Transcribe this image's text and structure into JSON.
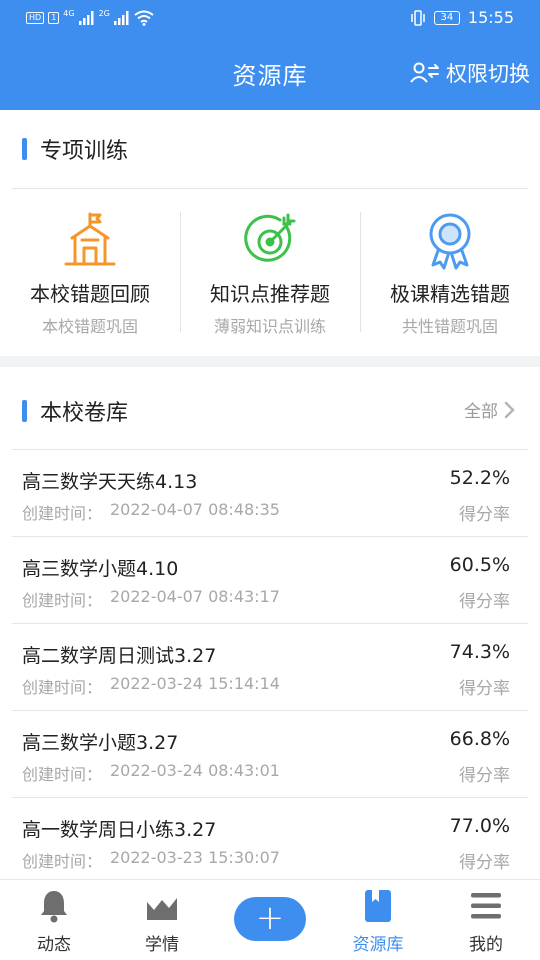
{
  "status_bar": {
    "hd_tag": "HD",
    "sim1_tag": "1",
    "signal1_type": "4G",
    "signal2_type": "2G",
    "battery": "34",
    "time": "15:55"
  },
  "header": {
    "title": "资源库",
    "switch_label": "权限切换"
  },
  "special_training": {
    "title": "专项训练",
    "items": [
      {
        "title": "本校错题回顾",
        "subtitle": "本校错题巩固",
        "icon": "school-building-icon",
        "color": "#f5962a"
      },
      {
        "title": "知识点推荐题",
        "subtitle": "薄弱知识点训练",
        "icon": "target-arrow-icon",
        "color": "#3cc14a"
      },
      {
        "title": "极课精选错题",
        "subtitle": "共性错题巩固",
        "icon": "award-ribbon-icon",
        "color": "#4d9bf0"
      }
    ]
  },
  "paper_library": {
    "title": "本校卷库",
    "more_label": "全部",
    "time_label": "创建时间：",
    "score_label": "得分率",
    "items": [
      {
        "name": "高三数学天天练4.13",
        "created": "2022-04-07 08:48:35",
        "score": "52.2%"
      },
      {
        "name": "高三数学小题4.10",
        "created": "2022-04-07 08:43:17",
        "score": "60.5%"
      },
      {
        "name": "高二数学周日测试3.27",
        "created": "2022-03-24 15:14:14",
        "score": "74.3%"
      },
      {
        "name": "高三数学小题3.27",
        "created": "2022-03-24 08:43:01",
        "score": "66.8%"
      },
      {
        "name": "高一数学周日小练3.27",
        "created": "2022-03-23 15:30:07",
        "score": "77.0%"
      }
    ]
  },
  "bottom_nav": {
    "add_label": "+",
    "items": [
      {
        "label": "动态",
        "icon": "bell-icon"
      },
      {
        "label": "学情",
        "icon": "chart-area-icon"
      },
      {
        "label": "资源库",
        "icon": "book-icon",
        "active": true
      },
      {
        "label": "我的",
        "icon": "menu-icon"
      }
    ]
  },
  "colors": {
    "primary": "#3e8ef0",
    "inactive_icon": "#6e6e6e"
  }
}
